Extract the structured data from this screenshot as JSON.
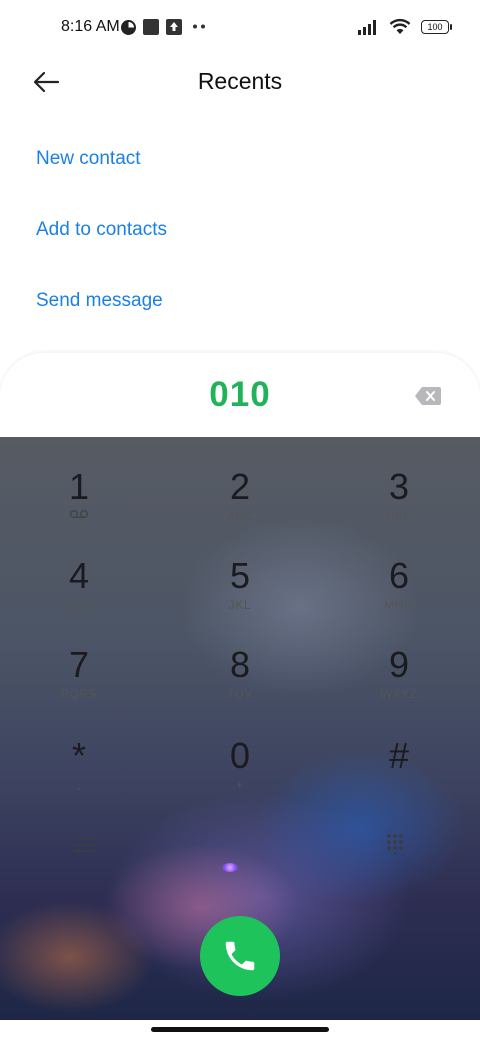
{
  "status_bar": {
    "time": "8:16 AM",
    "battery": "100",
    "icons": [
      "pie-chart-icon",
      "square-notification-icon",
      "upload-icon",
      "more-dots-icon",
      "signal-icon",
      "wifi-icon",
      "battery-icon"
    ]
  },
  "header": {
    "title": "Recents",
    "back_icon": "arrow-left-icon"
  },
  "actions": {
    "new_contact": "New contact",
    "add_to_contacts": "Add to contacts",
    "send_message": "Send message"
  },
  "dialer": {
    "entered_number": "010",
    "backspace_icon": "backspace-icon",
    "keys": [
      {
        "digit": "1",
        "letters": ""
      },
      {
        "digit": "2",
        "letters": "ABC"
      },
      {
        "digit": "3",
        "letters": "DEF"
      },
      {
        "digit": "4",
        "letters": "GHI"
      },
      {
        "digit": "5",
        "letters": "JKL"
      },
      {
        "digit": "6",
        "letters": "MNO"
      },
      {
        "digit": "7",
        "letters": "PQRS"
      },
      {
        "digit": "8",
        "letters": "TUV"
      },
      {
        "digit": "9",
        "letters": "WXYZ"
      },
      {
        "digit": "*",
        "letters": ","
      },
      {
        "digit": "0",
        "letters": "+"
      },
      {
        "digit": "#",
        "letters": ""
      }
    ],
    "bottom_icons": [
      "menu-icon",
      "keypad-grid-icon"
    ],
    "call_icon": "phone-icon"
  },
  "colors": {
    "accent_link": "#1a80e6",
    "number_green": "#22b35a",
    "call_green": "#1fc35c"
  }
}
